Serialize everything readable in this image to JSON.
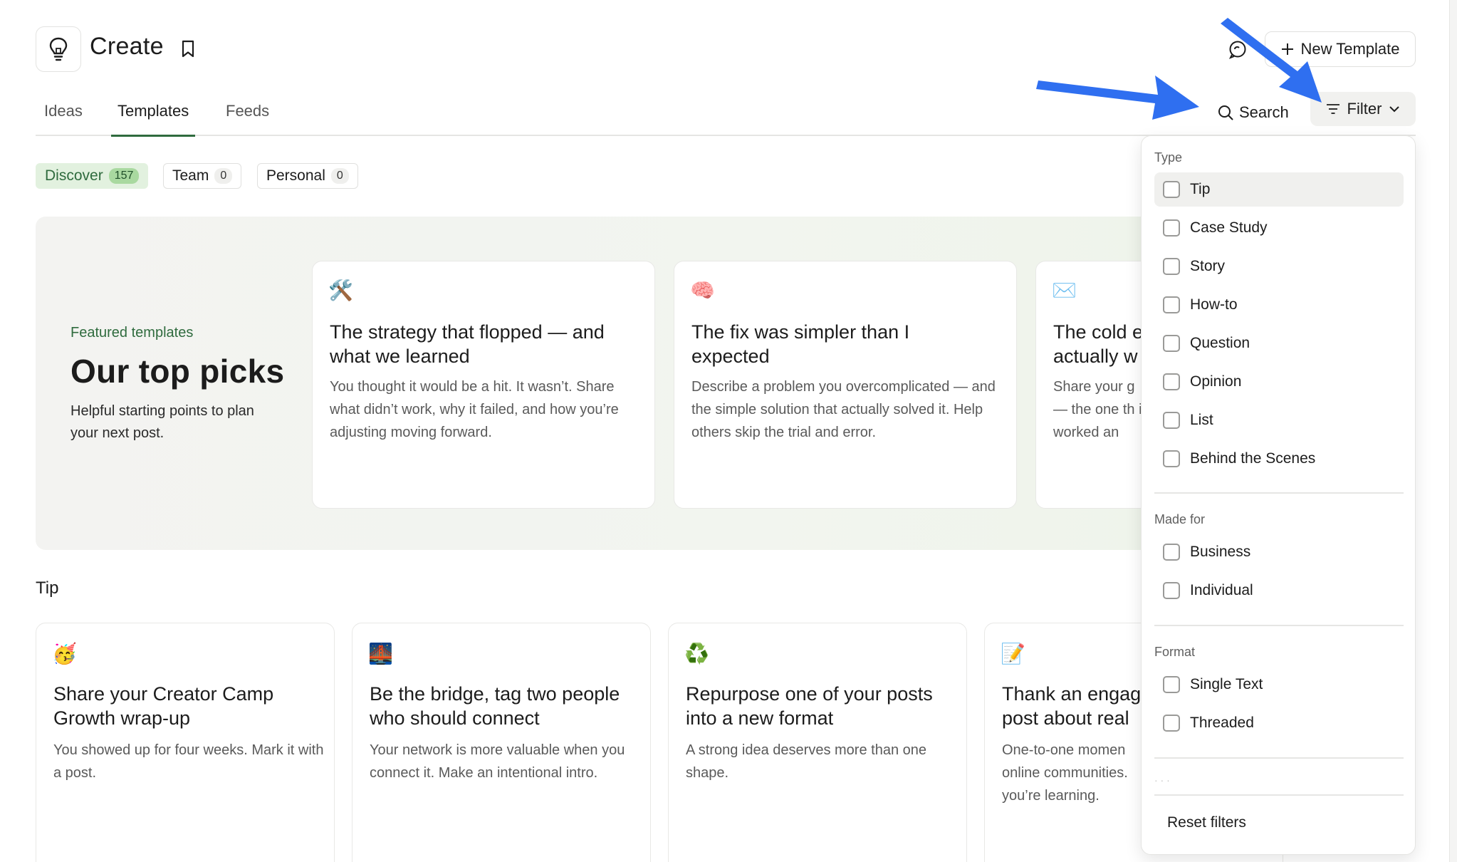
{
  "header": {
    "title": "Create",
    "new_template_label": "New Template"
  },
  "tabs": [
    {
      "label": "Ideas"
    },
    {
      "label": "Templates"
    },
    {
      "label": "Feeds"
    }
  ],
  "toolbar": {
    "search_label": "Search",
    "filter_label": "Filter"
  },
  "segments": [
    {
      "label": "Discover",
      "count": "157"
    },
    {
      "label": "Team",
      "count": "0"
    },
    {
      "label": "Personal",
      "count": "0"
    }
  ],
  "featured": {
    "label": "Featured templates",
    "title": "Our top picks",
    "description": "Helpful starting points to plan your next post.",
    "cards": [
      {
        "emoji": "🛠️",
        "title": "The strategy that flopped — and what we learned",
        "desc": "You thought it would be a hit. It wasn’t. Share what didn’t work, why it failed, and how you’re adjusting moving forward."
      },
      {
        "emoji": "🧠",
        "title": "The fix was simpler than I expected",
        "desc": "Describe a problem you overcomplicated — and the simple solution that actually solved it. Help others skip the trial and error."
      },
      {
        "emoji": "✉️",
        "title": "The cold e actually w",
        "desc": "Share your g — the one th it worked an"
      }
    ]
  },
  "tip_section": {
    "title": "Tip",
    "cards": [
      {
        "emoji": "🥳",
        "title": "Share your Creator Camp Growth wrap-up",
        "desc": "You showed up for four weeks. Mark it with a post."
      },
      {
        "emoji": "🌉",
        "title": "Be the bridge, tag two people who should connect",
        "desc": "Your network is more valuable when you connect it. Make an intentional intro."
      },
      {
        "emoji": "♻️",
        "title": "Repurpose one of your posts into a new format",
        "desc": "A strong idea deserves more than one shape."
      },
      {
        "emoji": "📝",
        "title": "Thank an engag post about real",
        "desc": "One-to-one momen online communities. you’re learning."
      }
    ]
  },
  "filter_dropdown": {
    "type_label": "Type",
    "type_options": [
      "Tip",
      "Case Study",
      "Story",
      "How-to",
      "Question",
      "Opinion",
      "List",
      "Behind the Scenes"
    ],
    "made_for_label": "Made for",
    "made_for_options": [
      "Business",
      "Individual"
    ],
    "format_label": "Format",
    "format_options": [
      "Single Text",
      "Threaded"
    ],
    "reset_label": "Reset filters"
  },
  "colors": {
    "accent_green": "#2f6b3e",
    "discover_bg": "#e2f1df",
    "annotation_arrow": "#2f6ff0"
  },
  "icons": [
    "lightbulb-icon",
    "bookmark-icon",
    "chat-icon",
    "plus-icon",
    "search-icon",
    "filter-icon",
    "chevron-down-icon",
    "annotation-arrow"
  ]
}
